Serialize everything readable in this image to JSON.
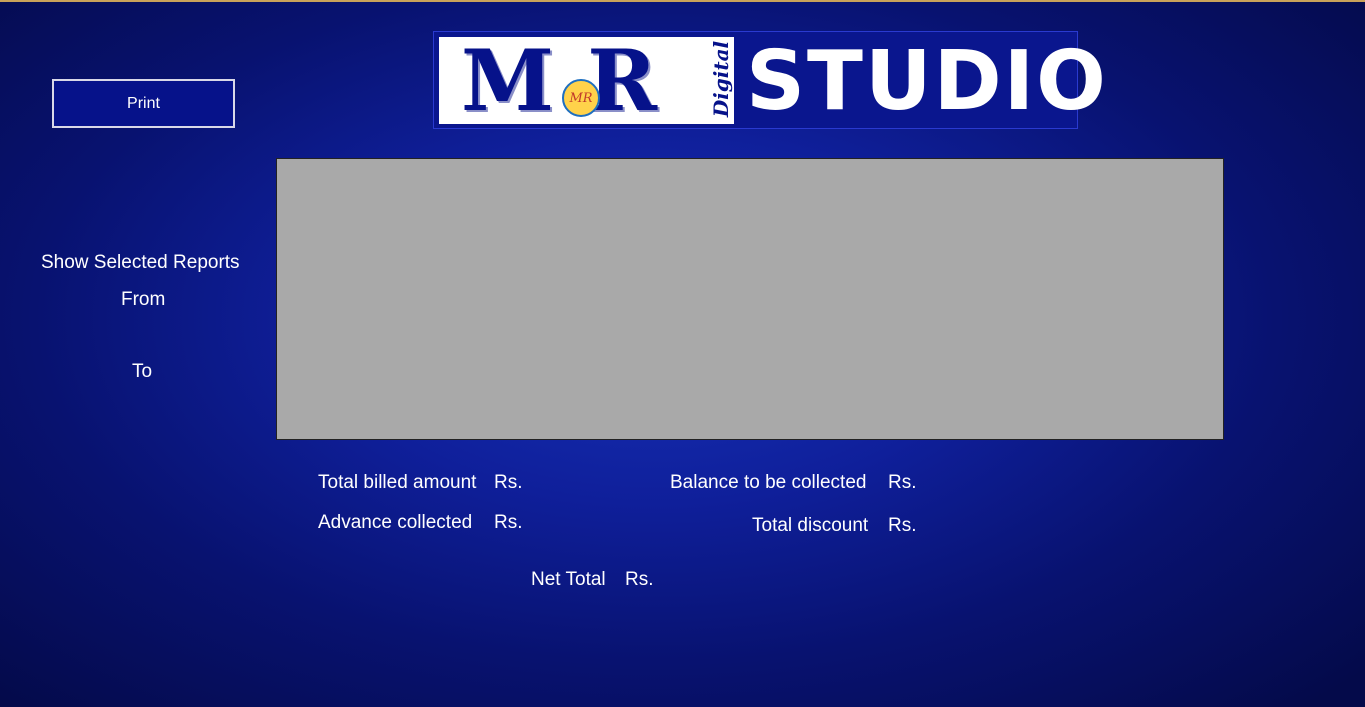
{
  "toolbar": {
    "print_label": "Print"
  },
  "logo": {
    "mr_text": "M R",
    "badge_text": "MR",
    "digital_text": "Digital",
    "studio_text": "STUDIO"
  },
  "filter": {
    "show_label": "Show Selected Reports",
    "from_label": "From",
    "to_label": "To"
  },
  "summary": {
    "total_billed_label": "Total billed amount",
    "advance_label": "Advance collected",
    "balance_label": "Balance to be collected",
    "discount_label": "Total discount",
    "net_total_label": "Net Total",
    "currency": "Rs."
  },
  "colors": {
    "background": "#0f1f9a",
    "button_bg": "#06128a",
    "report_area": "#a9a9a9",
    "accent_line": "#c9a25a"
  }
}
